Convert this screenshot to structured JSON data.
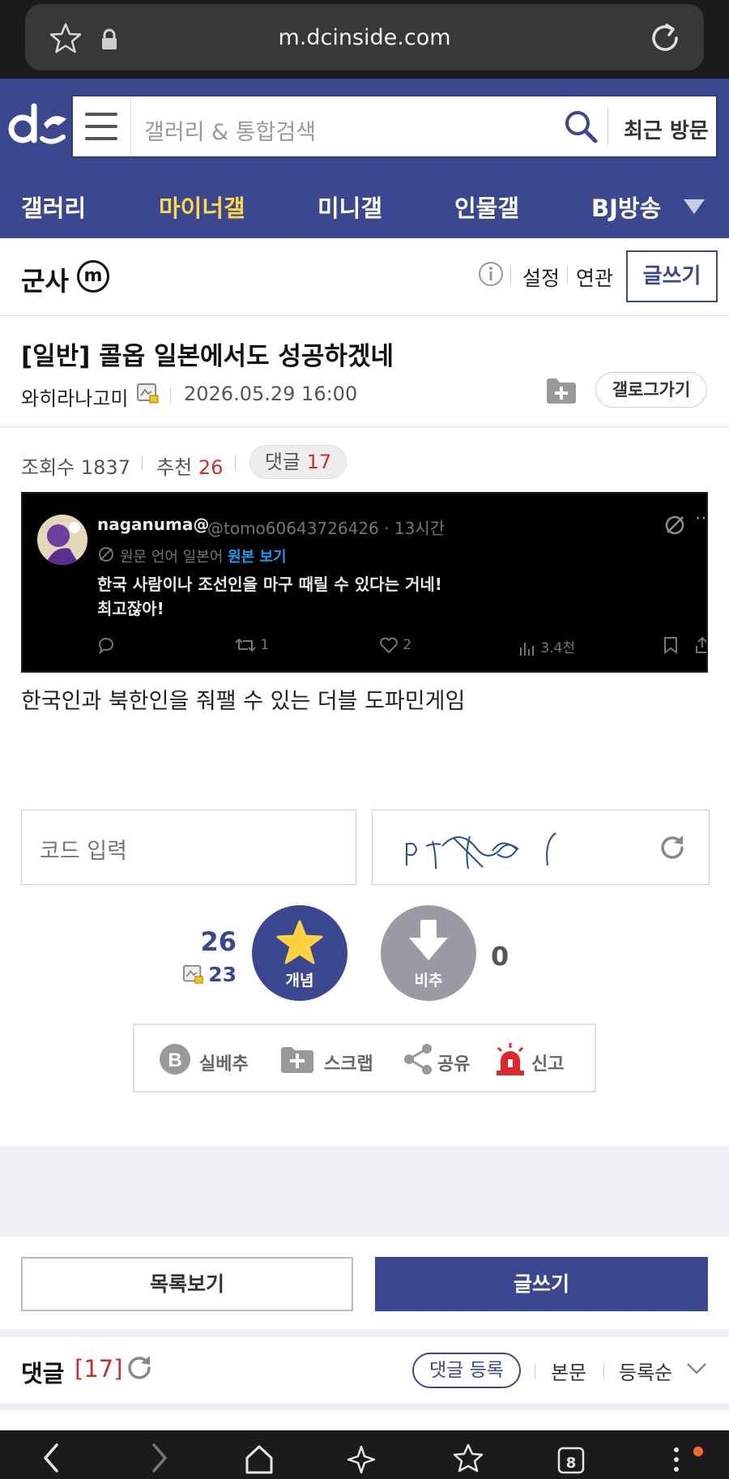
{
  "browser": {
    "url": "m.dcinside.com",
    "tab_count": "8"
  },
  "header": {
    "search_placeholder": "갤러리 & 통합검색",
    "recent_label": "최근 방문"
  },
  "nav": {
    "items": [
      {
        "label": "갤러리",
        "active": false
      },
      {
        "label": "마이너갤",
        "active": true
      },
      {
        "label": "미니갤",
        "active": false
      },
      {
        "label": "인물갤",
        "active": false
      },
      {
        "label": "BJ방송",
        "active": false
      }
    ]
  },
  "gallery": {
    "title": "군사",
    "badge": "m",
    "settings": "설정",
    "related": "연관",
    "write": "글쓰기"
  },
  "post": {
    "title": "[일반] 콜옵 일본에서도 성공하겠네",
    "author": "와히라나고미",
    "date": "2026.05.29 16:00",
    "gallog": "갤로그가기",
    "views_label": "조회수",
    "views": "1837",
    "rec_label": "추천",
    "rec": "26",
    "comments_label": "댓글",
    "comments": "17",
    "body": "한국인과 북한인을 줘팰 수 있는 더블 도파민게임"
  },
  "tweet": {
    "name": "naganuma@",
    "handle": "@tomo60643726426 · 13시간",
    "translated": "원문 언어 일본어",
    "show_original": "원본 보기",
    "line1": "한국 사람이나 조선인을 마구 때릴 수 있다는 거네!",
    "line2": "최고잖아!",
    "retweets": "1",
    "likes": "2",
    "views": "3.4천"
  },
  "captcha": {
    "placeholder": "코드 입력"
  },
  "recommend": {
    "up_count": "26",
    "fixed_count": "23",
    "up_label": "개념",
    "down_label": "비추",
    "down_count": "0"
  },
  "actions": [
    {
      "label": "실베추"
    },
    {
      "label": "스크랩"
    },
    {
      "label": "공유"
    },
    {
      "label": "신고"
    }
  ],
  "buttons": {
    "list": "목록보기",
    "write": "글쓰기"
  },
  "comments": {
    "title": "댓글",
    "count": "[17]",
    "register": "댓글 등록",
    "body": "본문",
    "sort": "등록순"
  },
  "colors": {
    "brand": "#3b4890",
    "active_nav": "#ffd84a",
    "accent_red": "#c9302c"
  }
}
